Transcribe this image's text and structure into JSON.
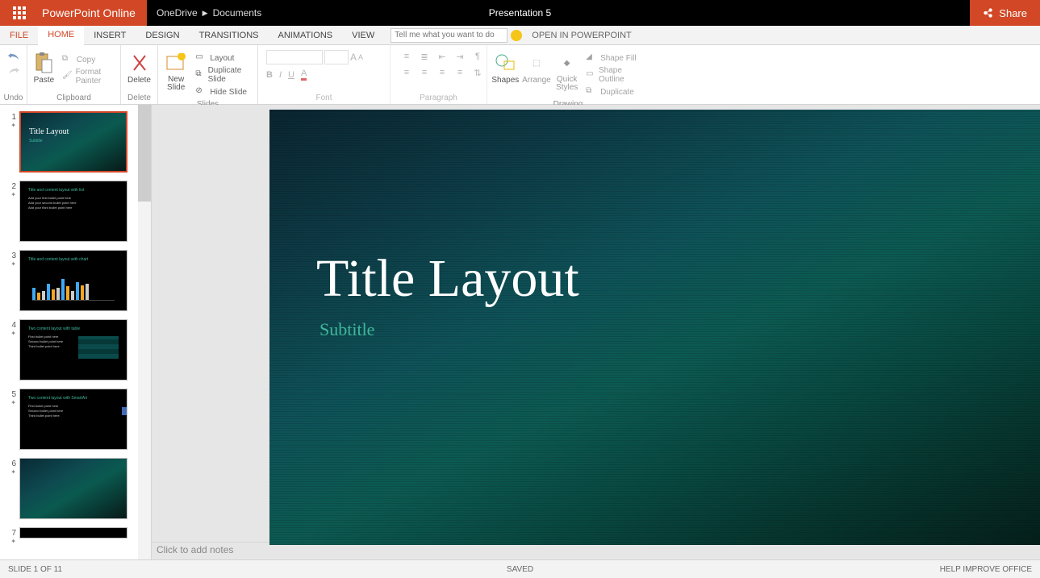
{
  "app": {
    "name": "PowerPoint Online"
  },
  "breadcrumb": {
    "root": "OneDrive",
    "folder": "Documents"
  },
  "document": {
    "title": "Presentation 5"
  },
  "share": {
    "label": "Share"
  },
  "tabs": {
    "file": "FILE",
    "home": "HOME",
    "insert": "INSERT",
    "design": "DESIGN",
    "transitions": "TRANSITIONS",
    "animations": "ANIMATIONS",
    "view": "VIEW",
    "tellme_placeholder": "Tell me what you want to do",
    "openinpp": "OPEN IN POWERPOINT"
  },
  "ribbon": {
    "undo": {
      "label": "Undo"
    },
    "clipboard": {
      "label": "Clipboard",
      "paste": "Paste",
      "copy": "Copy",
      "format_painter": "Format Painter"
    },
    "delete_grp": {
      "label": "Delete",
      "delete": "Delete"
    },
    "slides": {
      "label": "Slides",
      "new_slide": "New Slide",
      "layout": "Layout",
      "duplicate": "Duplicate Slide",
      "hide": "Hide Slide"
    },
    "font": {
      "label": "Font",
      "bold": "B",
      "italic": "I",
      "underline": "U"
    },
    "paragraph": {
      "label": "Paragraph"
    },
    "drawing": {
      "label": "Drawing",
      "shapes": "Shapes",
      "arrange": "Arrange",
      "quick_styles": "Quick Styles",
      "shape_fill": "Shape Fill",
      "shape_outline": "Shape Outline",
      "duplicate": "Duplicate"
    }
  },
  "thumbnails": [
    {
      "num": "1",
      "type": "title",
      "title": "Title Layout",
      "sub": "Subtitle"
    },
    {
      "num": "2",
      "type": "list",
      "title": "Title and content layout with list",
      "body": "Add your first bullet point here\nAdd your second bullet point here\nAdd your third bullet point here"
    },
    {
      "num": "3",
      "type": "chart",
      "title": "Title and content layout with chart"
    },
    {
      "num": "4",
      "type": "table",
      "title": "Two content layout with table",
      "body": "First bullet point here\nSecond bullet point here\nThird bullet point here"
    },
    {
      "num": "5",
      "type": "smartart",
      "title": "Two content layout with SmartArt",
      "body": "First bullet point here\nSecond bullet point here\nThird bullet point here"
    },
    {
      "num": "6",
      "type": "blank"
    },
    {
      "num": "7",
      "type": "blank"
    }
  ],
  "slide": {
    "title": "Title Layout",
    "subtitle": "Subtitle"
  },
  "notes": {
    "placeholder": "Click to add notes"
  },
  "status": {
    "left": "SLIDE 1 OF 11",
    "center": "SAVED",
    "right": "HELP IMPROVE OFFICE"
  }
}
